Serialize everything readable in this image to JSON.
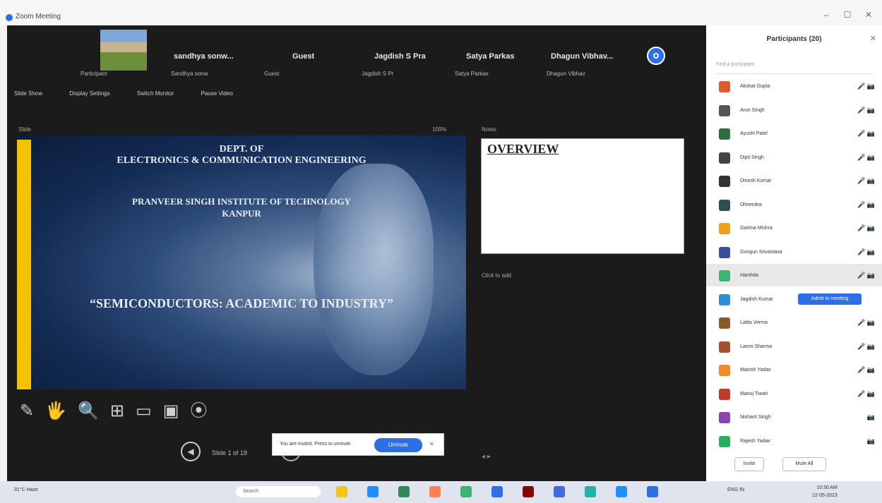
{
  "window": {
    "title": "Zoom Meeting",
    "controls": [
      "–",
      "☐",
      "✕"
    ]
  },
  "participants_strip": [
    {
      "name": "",
      "sub": "Participant"
    },
    {
      "name": "sandhya sonw...",
      "sub": "Sandhya sonw"
    },
    {
      "name": "Guest",
      "sub": "Guest"
    },
    {
      "name": "Jagdish S Pra",
      "sub": "Jagdish S Pr"
    },
    {
      "name": "Satya Parkas",
      "sub": "Satya Parkas"
    },
    {
      "name": "Dhagun Vibhav...",
      "sub": "Dhagun Vibhav"
    }
  ],
  "toolbar": {
    "view_label": "Slide Show",
    "items": [
      "Display Settings",
      "Switch Monitor",
      "Pause Video"
    ]
  },
  "slide_panel": {
    "label": "Slide",
    "zoom": "100%",
    "notes_label": "Notes"
  },
  "slide": {
    "line1": "DEPT. OF",
    "line2": "ELECTRONICS & COMMUNICATION ENGINEERING",
    "line3": "PRANVEER SINGH INSTITUTE OF TECHNOLOGY",
    "line4": "KANPUR",
    "headline": "“SEMICONDUCTORS: ACADEMIC TO INDUSTRY”"
  },
  "notes": {
    "text": "OVERVIEW",
    "footer": "Click to add"
  },
  "annotation_tools": [
    "✎",
    "🖐",
    "🔍",
    "⊞",
    "▭",
    "▣",
    "⦿"
  ],
  "navigation": {
    "slide_count": "Slide 1 of 18",
    "prev": "◀"
  },
  "notification": {
    "message": "You are muted. Press to unmute.",
    "button": "Unmute",
    "close": "✕"
  },
  "lower_controls": "◂ ▸",
  "panel": {
    "title": "Participants (20)",
    "close": "✕",
    "search_placeholder": "Find a participant",
    "rows": [
      {
        "name": "Akshat Gupta",
        "color": "#e05a2b",
        "icons": "🎤 📷"
      },
      {
        "name": "Arun Singh",
        "color": "#555555",
        "icons": "🎤 📷"
      },
      {
        "name": "Ayushi Patel",
        "color": "#2f6f3e",
        "icons": "🎤 📷"
      },
      {
        "name": "Dipti Singh",
        "color": "#444444",
        "icons": "🎤 📷"
      },
      {
        "name": "Dinesh Kumar",
        "color": "#333333",
        "icons": "🎤 📷"
      },
      {
        "name": "Dhirendra",
        "color": "#2f4f4f",
        "icons": "🎤 📷"
      },
      {
        "name": "Garima Mishra",
        "color": "#f0a020",
        "icons": "🎤 📷"
      },
      {
        "name": "Gungun Srivastava",
        "color": "#3a4f9a",
        "icons": "🎤 📷"
      },
      {
        "name": "Harshita",
        "color": "#3cb371",
        "icons": "🎤 📷",
        "highlight": true
      },
      {
        "name": "Jagdish Kumar",
        "color": "#2d8fd6",
        "icons": "",
        "admit": "Admit to meeting"
      },
      {
        "name": "Lalita Verma",
        "color": "#8b5a2b",
        "icons": "🎤 📷"
      },
      {
        "name": "Laxmi Sharma",
        "color": "#a0522d",
        "icons": "🎤 📷"
      },
      {
        "name": "Manish Yadav",
        "color": "#f08c2b",
        "icons": "🎤 📷"
      },
      {
        "name": "Manoj Tiwari",
        "color": "#c0392b",
        "icons": "🎤 📷"
      },
      {
        "name": "Nishant Singh",
        "color": "#8e44ad",
        "icons": "📷"
      },
      {
        "name": "Rajesh Yadav",
        "color": "#27ae60",
        "icons": "📷"
      }
    ],
    "footer": [
      "Invite",
      "Mute All"
    ]
  },
  "taskbar": {
    "weather": "31°C Haze",
    "search": "Search",
    "tray": "ENG IN",
    "time": "10:30 AM",
    "date": "12-05-2023",
    "icon_colors": [
      "#f5c518",
      "#1e90ff",
      "#2e8b57",
      "#ff7f50",
      "#3cb371",
      "#2d6fe6",
      "#8b0000",
      "#4169e1",
      "#20b2aa",
      "#1e90ff",
      "#2d6fe6"
    ]
  }
}
